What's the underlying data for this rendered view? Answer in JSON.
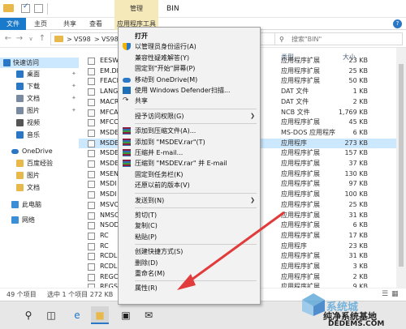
{
  "window": {
    "title": "BIN",
    "manage_tab": "管理",
    "tabs": {
      "file": "文件",
      "home": "主页",
      "share": "共享",
      "view": "查看",
      "app_tools": "应用程序工具"
    },
    "address": {
      "crumbs": [
        "VS98",
        "VS98"
      ],
      "search_placeholder": "搜索\"BIN\""
    },
    "help_icon": "?"
  },
  "columns": {
    "type": "类型",
    "size": "大小"
  },
  "nav": {
    "items": [
      {
        "label": "快速访问",
        "icon": "star-icon",
        "color": "#2a77c6"
      },
      {
        "label": "桌面",
        "icon": "desktop-icon",
        "color": "#2a77c6"
      },
      {
        "label": "下载",
        "icon": "download-icon",
        "color": "#2a77c6"
      },
      {
        "label": "文档",
        "icon": "documents-icon",
        "color": "#7a8aa0"
      },
      {
        "label": "图片",
        "icon": "pictures-icon",
        "color": "#7a8aa0"
      },
      {
        "label": "视频",
        "icon": "videos-icon",
        "color": "#555555"
      },
      {
        "label": "音乐",
        "icon": "music-icon",
        "color": "#2a77c6"
      },
      {
        "label": "OneDrive",
        "icon": "onedrive-icon",
        "color": "#2a77c6"
      },
      {
        "label": "百度经验",
        "icon": "folder-icon",
        "color": "#e9b84a"
      },
      {
        "label": "图片",
        "icon": "folder-icon",
        "color": "#e9b84a"
      },
      {
        "label": "文档",
        "icon": "folder-icon",
        "color": "#e9b84a"
      },
      {
        "label": "此电脑",
        "icon": "computer-icon",
        "color": "#3a8fd6"
      },
      {
        "label": "网络",
        "icon": "network-icon",
        "color": "#3a8fd6"
      }
    ]
  },
  "files": [
    {
      "name": "EESW",
      "type": "应用程序扩展",
      "size": "23 KB"
    },
    {
      "name": "EM.DI",
      "type": "应用程序扩展",
      "size": "25 KB"
    },
    {
      "name": "FEACP",
      "type": "应用程序扩展",
      "size": "50 KB"
    },
    {
      "name": "LANG",
      "type": "DAT 文件",
      "size": "1 KB"
    },
    {
      "name": "MACR",
      "type": "DAT 文件",
      "size": "2 KB"
    },
    {
      "name": "MFCA",
      "type": "NCB 文件",
      "size": "1,769 KB"
    },
    {
      "name": "MFCC",
      "type": "应用程序扩展",
      "size": "45 KB"
    },
    {
      "name": "MSDE",
      "type": "MS-DOS 应用程序",
      "size": "6 KB"
    },
    {
      "name": "MSDE",
      "type": "应用程序",
      "size": "273 KB"
    },
    {
      "name": "MSDE",
      "type": "应用程序扩展",
      "size": "157 KB"
    },
    {
      "name": "MSDE",
      "type": "应用程序扩展",
      "size": "37 KB"
    },
    {
      "name": "MSEN",
      "type": "应用程序扩展",
      "size": "130 KB"
    },
    {
      "name": "MSDI",
      "type": "应用程序扩展",
      "size": "97 KB"
    },
    {
      "name": "MSDI",
      "type": "应用程序扩展",
      "size": "100 KB"
    },
    {
      "name": "MSVC",
      "type": "应用程序扩展",
      "size": "25 KB"
    },
    {
      "name": "NMSC",
      "type": "应用程序扩展",
      "size": "31 KB"
    },
    {
      "name": "NSOD",
      "type": "应用程序扩展",
      "size": "6 KB"
    },
    {
      "name": "RC",
      "type": "应用程序扩展",
      "size": "17 KB"
    },
    {
      "name": "RC",
      "type": "应用程序",
      "size": "23 KB"
    },
    {
      "name": "RCDL",
      "type": "应用程序扩展",
      "size": "31 KB"
    },
    {
      "name": "RCDL",
      "type": "应用程序扩展",
      "size": "3 KB"
    },
    {
      "name": "REGC",
      "type": "应用程序扩展",
      "size": "2 KB"
    },
    {
      "name": "REGS",
      "type": "应用程序扩展",
      "size": "9 KB"
    }
  ],
  "menu": {
    "items": [
      {
        "label": "打开",
        "bold": true
      },
      {
        "label": "以管理员身份运行(A)",
        "icon": "shield"
      },
      {
        "label": "兼容性疑难解答(Y)"
      },
      {
        "label": "固定到\"开始\"屏幕(P)"
      },
      {
        "label": "移动到 OneDrive(M)",
        "icon": "cloud"
      },
      {
        "label": "使用 Windows Defender扫描...",
        "icon": "defender"
      },
      {
        "label": "共享",
        "icon": "share",
        "sep_after": true
      },
      {
        "label": "授予访问权限(G)",
        "arrow": true,
        "sep_after": true
      },
      {
        "label": "添加到压缩文件(A)...",
        "icon": "rar"
      },
      {
        "label": "添加到 \"MSDEV.rar\"(T)",
        "icon": "rar"
      },
      {
        "label": "压缩并 E-mail...",
        "icon": "rar"
      },
      {
        "label": "压缩到 \"MSDEV.rar\" 并 E-mail",
        "icon": "rar"
      },
      {
        "label": "固定到任务栏(K)"
      },
      {
        "label": "还原以前的版本(V)",
        "sep_after": true
      },
      {
        "label": "发送到(N)",
        "arrow": true,
        "sep_after": true
      },
      {
        "label": "剪切(T)"
      },
      {
        "label": "复制(C)"
      },
      {
        "label": "粘贴(P)",
        "sep_after": true
      },
      {
        "label": "创建快捷方式(S)"
      },
      {
        "label": "删除(D)"
      },
      {
        "label": "重命名(M)",
        "sep_after": true
      },
      {
        "label": "属性(R)"
      }
    ]
  },
  "status": {
    "count": "49 个项目",
    "selected": "选中 1 个项目 272 KB"
  },
  "taskbar": {
    "search_icon": "search-icon",
    "taskview_icon": "task-view-icon",
    "edge_icon": "edge-icon",
    "explorer_icon": "explorer-icon",
    "store_icon": "store-icon",
    "mail_icon": "mail-icon"
  },
  "watermark": {
    "line1": "系统城",
    "line2": "纯净系统基地",
    "line3": "DEDEMS.COM"
  },
  "colors": {
    "accent": "#1979ca",
    "selection": "#cce8ff",
    "manage": "#f5e9b9",
    "arrow": "#e23b3b"
  }
}
